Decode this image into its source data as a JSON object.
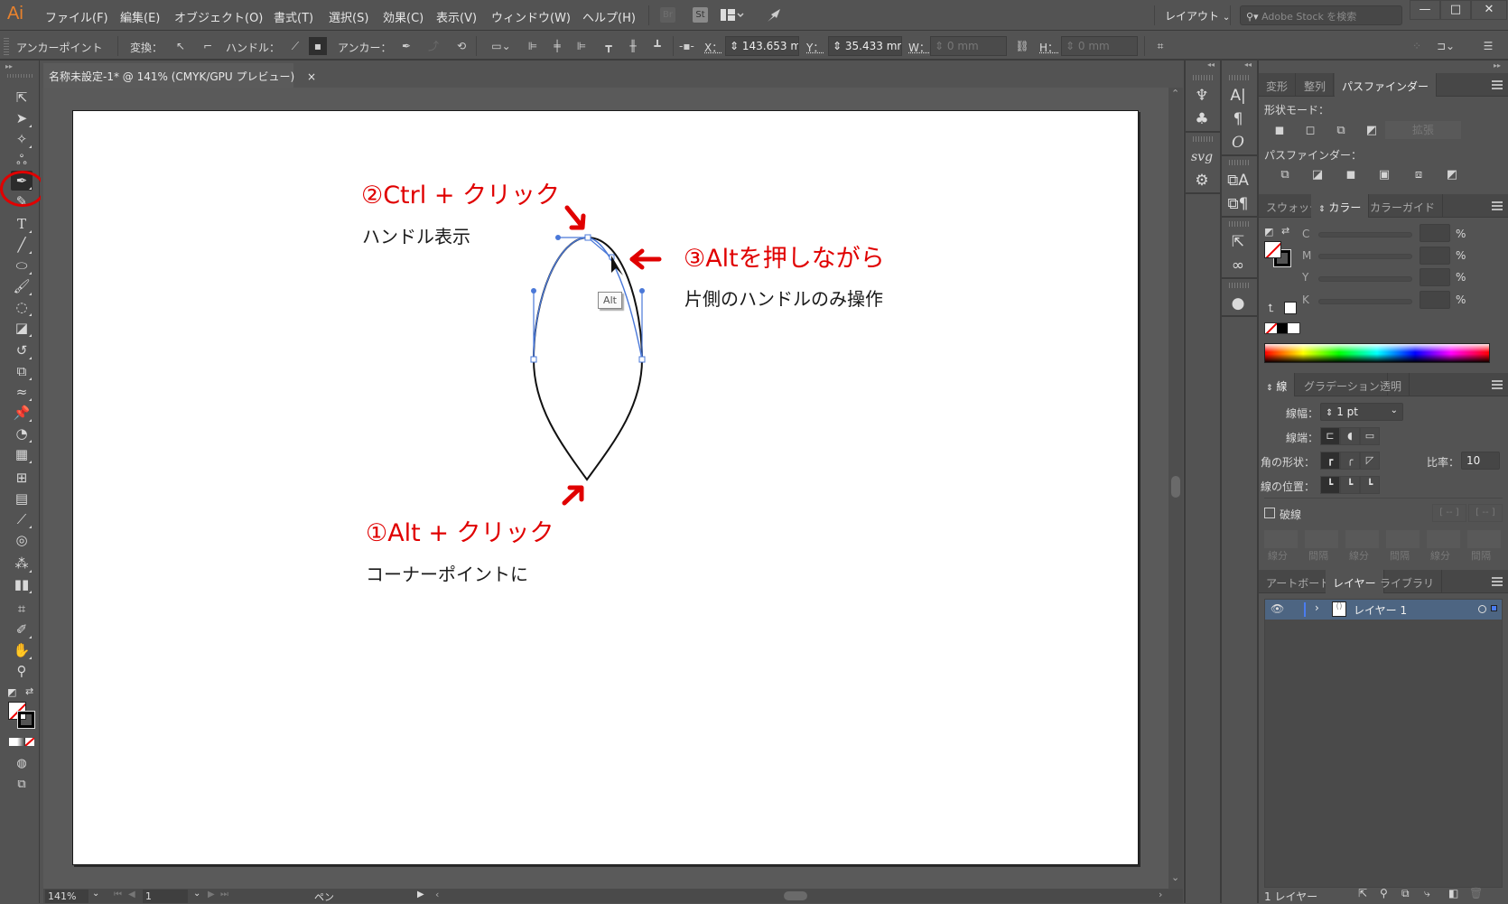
{
  "app": {
    "logo": "Ai",
    "window_controls": {
      "minimize": "—",
      "maximize": "□",
      "close": "✕"
    }
  },
  "menubar": {
    "items": [
      "ファイル(F)",
      "編集(E)",
      "オブジェクト(O)",
      "書式(T)",
      "選択(S)",
      "効果(C)",
      "表示(V)",
      "ウィンドウ(W)",
      "ヘルプ(H)"
    ],
    "bridge_label": "Br",
    "stock_label": "St",
    "workspace": "レイアウト",
    "search_placeholder": "Adobe Stock を検索"
  },
  "controlbar": {
    "selection_label": "アンカーポイント",
    "convert_label": "変換：",
    "handles_label": "ハンドル：",
    "anchors_label": "アンカー：",
    "x_label": "X：",
    "x_value": "143.653 m",
    "y_label": "Y：",
    "y_value": "35.433 mr",
    "w_label": "W：",
    "w_value": "0 mm",
    "h_label": "H：",
    "h_value": "0 mm"
  },
  "document": {
    "tab_title": "名称未設定-1* @ 141% (CMYK/GPU プレビュー)",
    "close_icon": "×"
  },
  "annotations": {
    "step2_title": "②Ctrl + クリック",
    "step2_desc": "ハンドル表示",
    "step3_title": "③Altを押しながら",
    "step3_desc": "片側のハンドルのみ操作",
    "step1_title": "①Alt + クリック",
    "step1_desc": "コーナーポイントに",
    "alt_tooltip": "Alt"
  },
  "statusbar": {
    "zoom": "141%",
    "artboard_number": "1",
    "current_tool": "ペン"
  },
  "panels": {
    "pathfinder": {
      "tabs": [
        "変形",
        "整列",
        "パスファインダー"
      ],
      "active_tab": "パスファインダー",
      "shape_modes_label": "形状モード：",
      "expand_label": "拡張",
      "pathfinders_label": "パスファインダー："
    },
    "color": {
      "tabs": [
        "スウォッチ",
        "カラー",
        "カラーガイド"
      ],
      "active_tab": "カラー",
      "channels": [
        {
          "name": "C",
          "value": "",
          "unit": "%"
        },
        {
          "name": "M",
          "value": "",
          "unit": "%"
        },
        {
          "name": "Y",
          "value": "",
          "unit": "%"
        },
        {
          "name": "K",
          "value": "",
          "unit": "%"
        }
      ]
    },
    "stroke": {
      "tabs": [
        "線",
        "グラデーション",
        "透明"
      ],
      "active_tab": "線",
      "weight_label": "線幅：",
      "weight_value": "1 pt",
      "cap_label": "線端：",
      "corner_label": "角の形状：",
      "limit_label": "比率：",
      "limit_value": "10",
      "align_label": "線の位置：",
      "dashed_label": "破線",
      "dashed_checked": false,
      "dash_fields": [
        "線分",
        "間隔",
        "線分",
        "間隔",
        "線分",
        "間隔"
      ]
    },
    "layers": {
      "tabs": [
        "アートボード",
        "レイヤー",
        "ライブラリ"
      ],
      "active_tab": "レイヤー",
      "layers": [
        {
          "name": "レイヤー 1",
          "visible": true
        }
      ],
      "footer_count": "1 レイヤー"
    }
  },
  "colors": {
    "accent_annotation": "#e00000",
    "path_selection": "#4a78d8",
    "layer_highlight": "#4d6582"
  }
}
